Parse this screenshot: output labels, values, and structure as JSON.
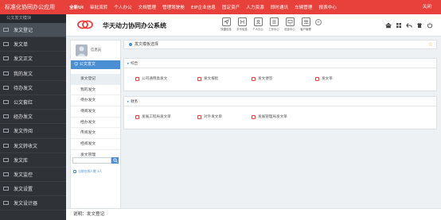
{
  "app": {
    "brand": "标准化协同办公应用",
    "title": "华天动力协同办公系统",
    "colors": {
      "accent": "#e8413c",
      "nav_bg": "#2f3237",
      "blue": "#4a8ed4"
    }
  },
  "topnav": {
    "tabs": [
      "全新UI",
      "审批流转",
      "个人办公",
      "文档管理",
      "管理驾驶舱",
      "EIP企业信息",
      "固定资产",
      "人力资源",
      "即时通讯",
      "车辆管理",
      "报表中心"
    ],
    "close_label": "关闭"
  },
  "sidebar": {
    "module_title": "公文发文模块",
    "items": [
      "发文登记",
      "发文单",
      "发文正文",
      "我的发文",
      "待办发文",
      "公文套红",
      "经办发文",
      "发文传阅",
      "发文转收文",
      "发文库",
      "发文监控",
      "发文设置",
      "发文设计器"
    ]
  },
  "header": {
    "quick_links": [
      "快捷信息",
      "手写信息",
      "个人办公",
      "工作中心",
      "信息中心",
      "客户管理"
    ],
    "right_icons": [
      "home-icon",
      "grid-icon",
      "back-icon",
      "shirt-icon",
      "power-icon"
    ]
  },
  "user_panel": {
    "name": "信息员",
    "menu_title": "公文发文",
    "submenu": [
      "发文登记",
      "我的发文",
      "待办发文",
      "待阅发文",
      "经办发文",
      "传阅发文",
      "经阅发文",
      "发文管理"
    ],
    "online_label": "当前在线人数 3人"
  },
  "main": {
    "breadcrumb": "发文模板选择",
    "groups": [
      {
        "title": "综合",
        "items": [
          "公司通用类发文",
          "发文报批",
          "发文便签",
          "发文单"
        ]
      },
      {
        "title": "财务",
        "items": [
          "发展工程局发文单",
          "对外发文单",
          "发展管理局发文单"
        ]
      }
    ]
  },
  "footer": {
    "status": "说明：发文登记"
  }
}
